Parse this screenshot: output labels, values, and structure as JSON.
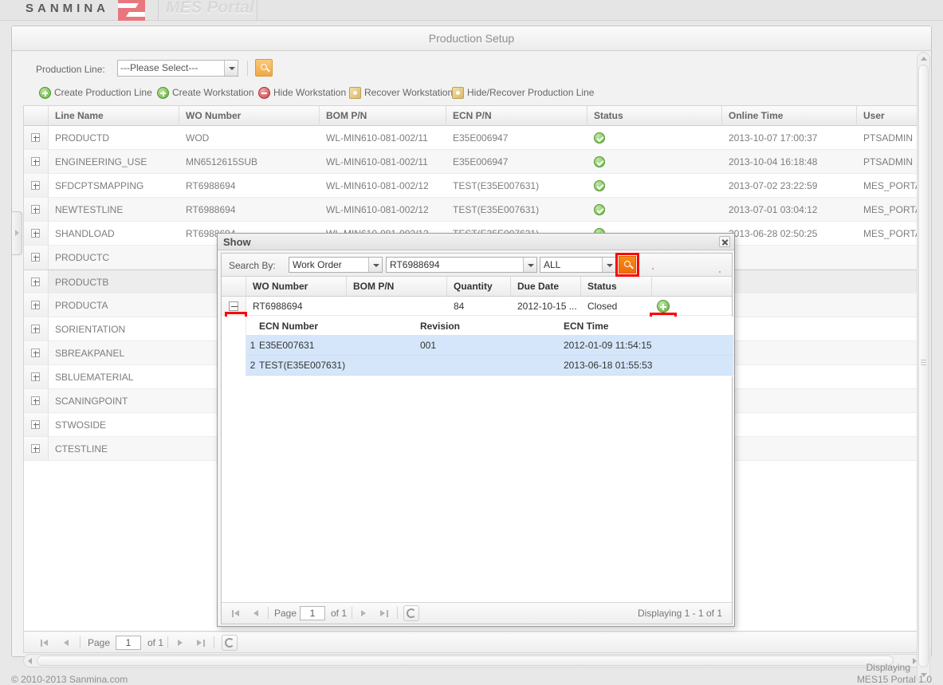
{
  "brand": {
    "company": "SANMINA",
    "product": "MES Portal"
  },
  "page": {
    "title": "Production Setup"
  },
  "search_row": {
    "label": "Production Line:",
    "select_value": "---Please Select---",
    "search_icon": "search-icon"
  },
  "toolbar": {
    "buttons": [
      {
        "label": "Create Production Line",
        "icon": "add-circle-icon"
      },
      {
        "label": "Create Workstation",
        "icon": "add-circle-icon"
      },
      {
        "label": "Hide Workstation",
        "icon": "remove-circle-icon"
      },
      {
        "label": "Recover Workstation",
        "icon": "gear-icon"
      },
      {
        "label": "Hide/Recover Production Line",
        "icon": "gear-icon"
      }
    ]
  },
  "grid": {
    "columns": [
      "Line Name",
      "WO Number",
      "BOM P/N",
      "ECN P/N",
      "Status",
      "Online Time",
      "User"
    ],
    "rows": [
      {
        "line": "PRODUCTD",
        "wo": "WOD",
        "bom": "WL-MIN610-081-002/11",
        "ecn": "E35E006947",
        "status": "ok",
        "online": "2013-10-07 17:00:37",
        "user": "PTSADMIN"
      },
      {
        "line": "ENGINEERING_USE",
        "wo": "MN6512615SUB",
        "bom": "WL-MIN610-081-002/11",
        "ecn": "E35E006947",
        "status": "ok",
        "online": "2013-10-04 16:18:48",
        "user": "PTSADMIN"
      },
      {
        "line": "SFDCPTSMAPPING",
        "wo": "RT6988694",
        "bom": "WL-MIN610-081-002/12",
        "ecn": "TEST(E35E007631)",
        "status": "ok",
        "online": "2013-07-02 23:22:59",
        "user": "MES_PORTAL"
      },
      {
        "line": "NEWTESTLINE",
        "wo": "RT6988694",
        "bom": "WL-MIN610-081-002/12",
        "ecn": "TEST(E35E007631)",
        "status": "ok",
        "online": "2013-07-01 03:04:12",
        "user": "MES_PORTAL"
      },
      {
        "line": "SHANDLOAD",
        "wo": "RT6988694",
        "bom": "WL-MIN610-081-002/12",
        "ecn": "TEST(E35E007631)",
        "status": "ok",
        "online": "2013-06-28 02:50:25",
        "user": "MES_PORTAL"
      },
      {
        "line": "PRODUCTC",
        "wo": "",
        "bom": "",
        "ecn": "",
        "status": "",
        "online": "",
        "user": ""
      },
      {
        "line": "PRODUCTB",
        "wo": "",
        "bom": "",
        "ecn": "",
        "status": "",
        "online": "",
        "user": ""
      },
      {
        "line": "PRODUCTA",
        "wo": "",
        "bom": "",
        "ecn": "",
        "status": "",
        "online": "",
        "user": ""
      },
      {
        "line": "SORIENTATION",
        "wo": "",
        "bom": "",
        "ecn": "",
        "status": "",
        "online": "",
        "user": ""
      },
      {
        "line": "SBREAKPANEL",
        "wo": "",
        "bom": "",
        "ecn": "",
        "status": "",
        "online": "",
        "user": ""
      },
      {
        "line": "SBLUEMATERIAL",
        "wo": "",
        "bom": "",
        "ecn": "",
        "status": "",
        "online": "",
        "user": ""
      },
      {
        "line": "SCANINGPOINT",
        "wo": "",
        "bom": "",
        "ecn": "",
        "status": "",
        "online": "",
        "user": ""
      },
      {
        "line": "STWOSIDE",
        "wo": "",
        "bom": "",
        "ecn": "",
        "status": "",
        "online": "",
        "user": ""
      },
      {
        "line": "CTESTLINE",
        "wo": "",
        "bom": "",
        "ecn": "",
        "status": "",
        "online": "",
        "user": ""
      }
    ]
  },
  "main_pager": {
    "page_label": "Page",
    "page_value": "1",
    "of_label": "of 1",
    "displaying": "Displaying"
  },
  "modal": {
    "title": "Show",
    "close_icon": "close-icon",
    "search": {
      "label": "Search By:",
      "type_value": "Work Order",
      "keyword_value": "RT6988694",
      "scope_value": "ALL",
      "search_icon": "search-icon"
    },
    "columns": [
      "WO Number",
      "BOM P/N",
      "Quantity",
      "Due Date",
      "Status"
    ],
    "row": {
      "wo": "RT6988694",
      "bom": "",
      "quantity": "84",
      "due_date": "2012-10-15 ...",
      "status": "Closed",
      "add_icon": "add-circle-icon",
      "collapse_icon": "minus-expander-icon"
    },
    "subgrid": {
      "columns": [
        "ECN Number",
        "Revision",
        "ECN Time"
      ],
      "rows": [
        {
          "num": "1",
          "ecn": "E35E007631",
          "revision": "001",
          "time": "2012-01-09 11:54:15"
        },
        {
          "num": "2",
          "ecn": "TEST(E35E007631)",
          "revision": "",
          "time": "2013-06-18 01:55:53"
        }
      ]
    },
    "pager": {
      "page_label": "Page",
      "page_value": "1",
      "of_label": "of 1",
      "displaying": "Displaying 1 - 1 of 1"
    }
  },
  "footer": {
    "copyright": "© 2010-2013 Sanmina.com",
    "version": "MES15 Portal 1.0"
  },
  "colors": {
    "highlight_red": "#ff0000",
    "accent_orange": "#ef6d06",
    "status_green": "#5fae3b",
    "subrow_blue": "#d6e6fa"
  }
}
